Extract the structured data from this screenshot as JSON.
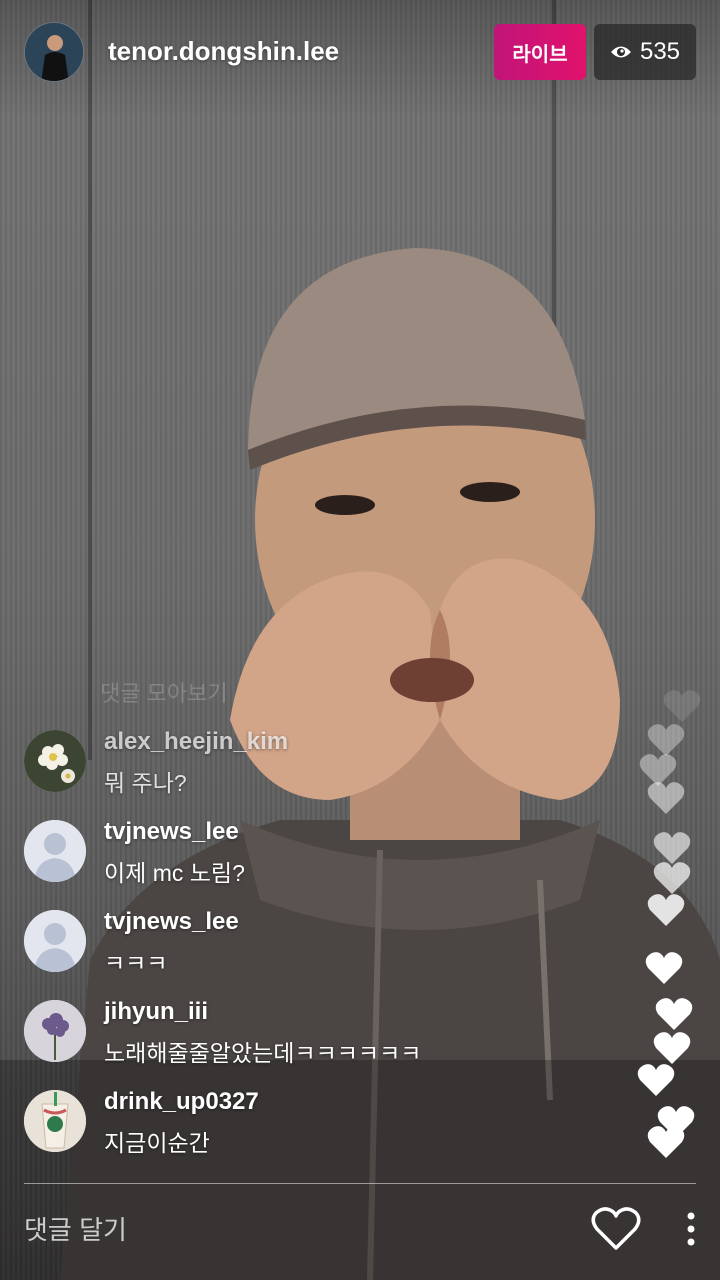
{
  "header": {
    "username": "tenor.dongshin.lee",
    "live_label": "라이브",
    "viewer_count": "535",
    "viewer_icon": "eye-icon"
  },
  "ghost_comment": "댓글 모아보기",
  "comments": [
    {
      "user": "alex_heejin_kim",
      "text": "뭐 주나?",
      "avatar": "flower-photo"
    },
    {
      "user": "tvjnews_lee",
      "text": "이제 mc 노림?",
      "avatar": "default-person-icon"
    },
    {
      "user": "tvjnews_lee",
      "text": "ㅋㅋㅋ",
      "avatar": "default-person-icon"
    },
    {
      "user": "jihyun_iii",
      "text": "노래해줄줄알았는데ㅋㅋㅋㅋㅋㅋ",
      "avatar": "lilac-photo"
    },
    {
      "user": "drink_up0327",
      "text": "지금이순간",
      "avatar": "drink-photo"
    }
  ],
  "footer": {
    "comment_placeholder": "댓글 달기",
    "like_icon": "heart-outline-icon",
    "more_icon": "more-vertical-icon"
  },
  "colors": {
    "live_badge": "#d6136f",
    "viewer_badge": "#2b2b2b"
  }
}
